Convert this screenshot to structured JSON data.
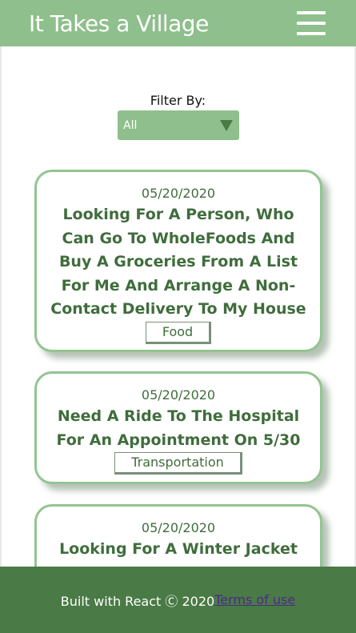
{
  "header": {
    "title": "It Takes a Village",
    "menu_icon": "hamburger-menu-icon"
  },
  "filter": {
    "label": "Filter By:",
    "selected": "All"
  },
  "posts": [
    {
      "date": "05/20/2020",
      "title": "Looking For A Person, Who Can Go To WholeFoods And Buy A Groceries From A List For Me And Arrange A Non-Contact Delivery To My House",
      "category": "Food"
    },
    {
      "date": "05/20/2020",
      "title": "Need A Ride To The Hospital For An Appointment On 5/30",
      "category": "Transportation"
    },
    {
      "date": "05/20/2020",
      "title": "Looking For A Winter Jacket",
      "category": ""
    }
  ],
  "footer": {
    "text": "Built with React Ⓒ 2020",
    "link": "Terms of use"
  },
  "colors": {
    "header_bg": "#8fbf8c",
    "footer_bg": "#4a7a45",
    "card_border": "#93c491",
    "text_green": "#3f6d3c"
  }
}
